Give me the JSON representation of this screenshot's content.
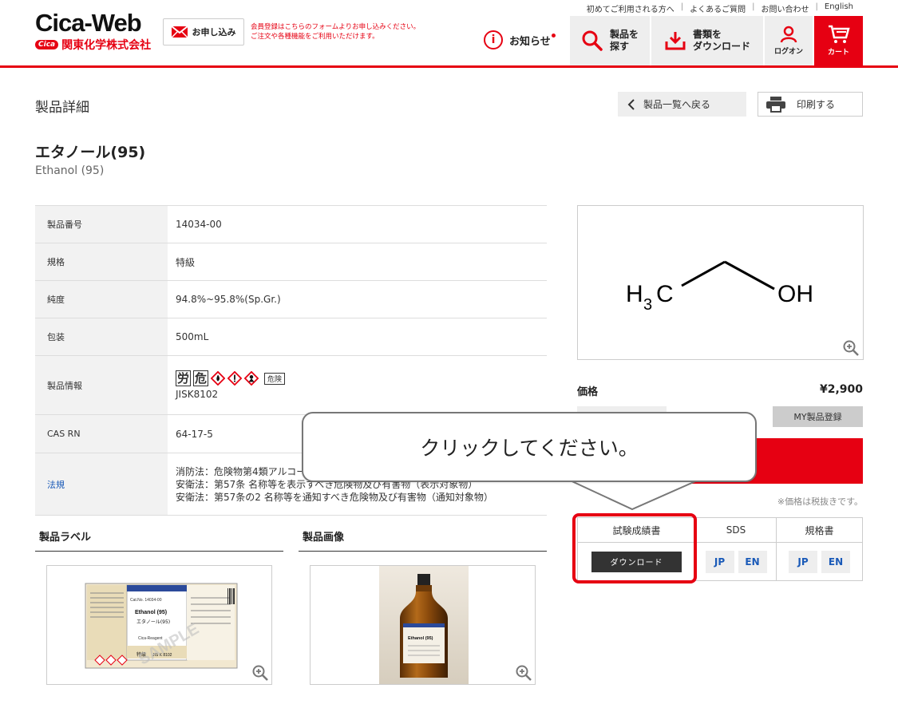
{
  "top_links": [
    "初めてご利用される方へ",
    "よくあるご質問",
    "お問い合わせ",
    "English"
  ],
  "logo": {
    "brand": "Cica-Web",
    "badge": "Cica",
    "company": "関東化学株式会社"
  },
  "apply": {
    "label": "お申し込み",
    "note_line1": "会員登録はこちらのフォームよりお申し込みください。",
    "note_line2": "ご注文や各種機能をご利用いただけます。"
  },
  "notice": {
    "icon": "i",
    "label": "お知らせ"
  },
  "nav": {
    "search_line1": "製品を",
    "search_line2": "探す",
    "download_line1": "書類を",
    "download_line2": "ダウンロード",
    "login": "ログオン",
    "cart": "カート"
  },
  "page": {
    "title": "製品詳細",
    "back": "製品一覧へ戻る",
    "print": "印刷する"
  },
  "product": {
    "name_jp": "エタノール(95)",
    "name_en": "Ethanol (95)"
  },
  "spec": {
    "rows": [
      {
        "key": "製品番号",
        "value": "14034-00"
      },
      {
        "key": "規格",
        "value": "特級"
      },
      {
        "key": "純度",
        "value": "94.8%~95.8%(Sp.Gr.)"
      },
      {
        "key": "包装",
        "value": "500mL"
      }
    ],
    "info_key": "製品情報",
    "info_kanji1": "労",
    "info_kanji2": "危",
    "info_tag": "危険",
    "info_jis": "JISK8102",
    "cas_key": "CAS RN",
    "cas_value": "64-17-5",
    "law_key": "法規",
    "law_line1": "消防法：危険物第4類アルコール",
    "law_line2": "安衛法：第57条 名称等を表示すべき危険物及び有害物（表示対象物）",
    "law_line3": "安衛法：第57条の2 名称等を通知すべき危険物及び有害物（通知対象物）"
  },
  "structure": {
    "left": "H",
    "sub": "3",
    "c": "C",
    "right": "OH"
  },
  "price": {
    "label": "価格",
    "value": "¥2,900",
    "my_button": "MY製品登録",
    "tax_note": "※価格は税抜きです。"
  },
  "docs": {
    "coa": "試験成績書",
    "coa_button": "ダウンロード",
    "sds": "SDS",
    "spec_sheet": "規格書",
    "jp": "JP",
    "en": "EN"
  },
  "callout": "クリックしてください。",
  "sections": {
    "label": "製品ラベル",
    "image": "製品画像"
  },
  "label_sample": {
    "title": "Ethanol (95)",
    "jp": "エタノール(95)",
    "code": "Cat.No. 14034-00",
    "grade": "Cica-Reagent",
    "sample": "SAMPLE",
    "jis": "JIS K 8102",
    "tokkyu": "特級"
  },
  "bottle_label": "Ethanol (95)",
  "colors": {
    "accent": "#e60012",
    "link": "#1a5ab8"
  },
  "icons": [
    "mail-icon",
    "info-icon",
    "search-icon",
    "download-icon",
    "user-icon",
    "cart-icon",
    "chevron-left-icon",
    "printer-icon",
    "zoom-in-icon"
  ]
}
